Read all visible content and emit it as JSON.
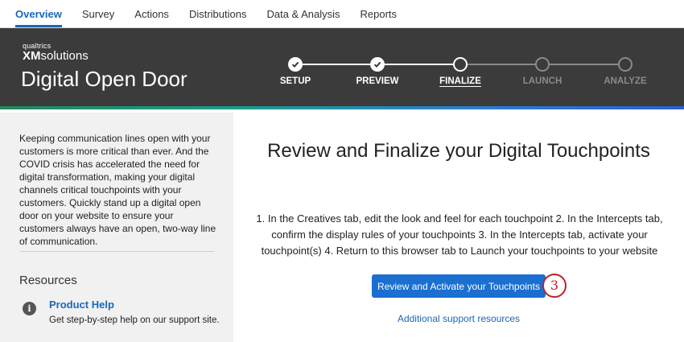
{
  "topnav": {
    "tabs": [
      {
        "label": "Overview",
        "active": true
      },
      {
        "label": "Survey",
        "active": false
      },
      {
        "label": "Actions",
        "active": false
      },
      {
        "label": "Distributions",
        "active": false
      },
      {
        "label": "Data & Analysis",
        "active": false
      },
      {
        "label": "Reports",
        "active": false
      }
    ]
  },
  "banner": {
    "logo_small": "qualtrics",
    "logo_xm": "XM",
    "logo_solutions": "solutions",
    "title": "Digital Open Door"
  },
  "stepper": {
    "steps": [
      {
        "label": "SETUP",
        "state": "done"
      },
      {
        "label": "PREVIEW",
        "state": "done"
      },
      {
        "label": "FINALIZE",
        "state": "current"
      },
      {
        "label": "LAUNCH",
        "state": "todo"
      },
      {
        "label": "ANALYZE",
        "state": "todo"
      }
    ]
  },
  "sidebar": {
    "intro": "Keeping communication lines open with your customers is more critical than ever. And the COVID crisis has accelerated the need for digital transformation, making your digital channels critical touchpoints with your customers. Quickly stand up a digital open door on your website to ensure your customers always have an open, two-way line of communication.",
    "resources_title": "Resources",
    "info_icon": "i",
    "help_link": "Product Help",
    "help_desc": "Get step-by-step help on our support site."
  },
  "main": {
    "title": "Review and Finalize your Digital Touchpoints",
    "description": "1. In the Creatives tab, edit the look and feel for each touchpoint 2. In the Intercepts tab, confirm the display rules of your touchpoints 3. In the Intercepts tab, activate your touchpoint(s) 4. Return to this browser tab to Launch your touchpoints to your website",
    "primary_button": "Review and Activate your Touchpoints",
    "callout_number": "3",
    "support_link": "Additional support resources"
  },
  "colors": {
    "accent": "#1a68b9",
    "button": "#1a6fd1",
    "banner": "#3b3b3b",
    "callout": "#c0202a"
  }
}
